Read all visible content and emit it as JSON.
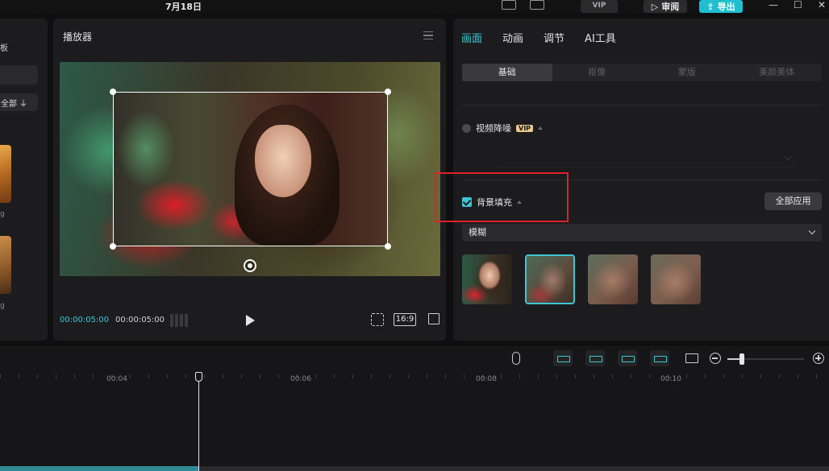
{
  "topbar": {
    "date": "7月18日",
    "vip_label": "VIP",
    "review_label": "审阅",
    "export_label": "导出",
    "minimize": "—",
    "maximize": "☐",
    "close": "✕"
  },
  "media_panel": {
    "label": "板",
    "filter_label": "全部",
    "thumb_labels": [
      "g",
      "g"
    ]
  },
  "player": {
    "title": "播放器",
    "current_time": "00:00:05:00",
    "total_time": "00:00:05:00",
    "ratio": "16:9"
  },
  "properties": {
    "tabs": [
      {
        "label": "画面",
        "active": true
      },
      {
        "label": "动画",
        "active": false
      },
      {
        "label": "调节",
        "active": false
      },
      {
        "label": "AI工具",
        "active": false
      }
    ],
    "subtabs": [
      {
        "label": "基础",
        "active": true
      },
      {
        "label": "抠像",
        "active": false
      },
      {
        "label": "蒙版",
        "active": false
      },
      {
        "label": "美颜美体",
        "active": false
      }
    ],
    "denoise_label": "视频降噪",
    "denoise_vip": "VIP",
    "bg_fill_label": "背景填充",
    "apply_all_label": "全部应用",
    "fill_mode": "模糊",
    "blur_levels": 4,
    "selected_blur": 1
  },
  "timeline": {
    "ticks": [
      "00:04",
      "00:06",
      "00:08",
      "00:10"
    ]
  },
  "colors": {
    "accent": "#3fc6d4",
    "highlight_box": "#e0202a",
    "export_button": "#1fbfcf"
  }
}
